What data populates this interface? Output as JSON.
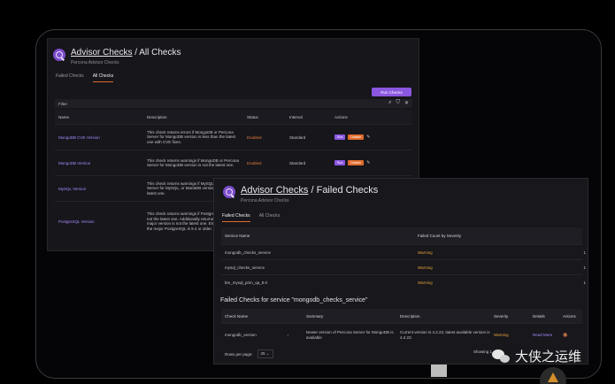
{
  "all_checks": {
    "title_link": "Advisor Checks",
    "title_rest": "/ All Checks",
    "subtitle": "Percona Advisor Checks",
    "tabs": [
      "Failed Checks",
      "All Checks"
    ],
    "run_button": "Run Checks",
    "filter_label": "Filter",
    "columns": [
      "Name",
      "Description",
      "Status",
      "Interval",
      "Actions"
    ],
    "rows": [
      {
        "name": "MongoDB CVE Version",
        "description": "This check returns errors if MongoDB or Percona Server for MongoDB version is less than the latest one with CVE fixes.",
        "status": "Enabled",
        "interval": "Standard"
      },
      {
        "name": "MongoDB Version",
        "description": "This check returns warnings if MongoDB or Percona Server for MongoDB version is not the latest one.",
        "status": "Enabled",
        "interval": "Standard"
      },
      {
        "name": "MySQL Version",
        "description": "This check returns warnings if MySQL, Percona Server for MySQL, or MariaDB version is not the latest one.",
        "status": "",
        "interval": ""
      },
      {
        "name": "PostgreSQL Version",
        "description": "This check returns warnings if PostgreSQL version is not the latest one. Additionally returned if PostgreSQL major version is not the latest one. Error is returned if the major PostgreSQL is 9.4 or older.",
        "status": "",
        "interval": ""
      }
    ],
    "run_label": "Run",
    "disable_label": "Disable"
  },
  "failed_checks": {
    "title_link": "Advisor Checks",
    "title_rest": "/ Failed Checks",
    "subtitle": "Percona Advisor Checks",
    "tabs": [
      "Failed Checks",
      "All Checks"
    ],
    "columns": [
      "Service Name",
      "Failed Count by Severity"
    ],
    "rows": [
      {
        "service": "mongodb_checks_service",
        "severity": "Warning",
        "count": "1"
      },
      {
        "service": "mysql_checks_service",
        "severity": "Warning",
        "count": "1"
      },
      {
        "service": "bm_mysql_prim_qa_8.0",
        "severity": "Warning",
        "count": "1"
      }
    ],
    "section_title": "Failed Checks for service \"mongodb_checks_service\"",
    "detail_columns": [
      "Check Name",
      "",
      "Summary",
      "Description",
      "Severity",
      "Details",
      "Actions"
    ],
    "detail_row": {
      "check": "mongodb_version",
      "summary": "Newer version of Percona Server for MongoDB is available",
      "description": "Current version is 4.2.23, latest available version is 4.2.23.",
      "severity": "Warning",
      "details": "Read More"
    },
    "rows_per_page_label": "Rows per page:",
    "rows_per_page_value": "25",
    "showing": "Showing 1"
  },
  "watermark": {
    "text": "大侠之运维"
  }
}
